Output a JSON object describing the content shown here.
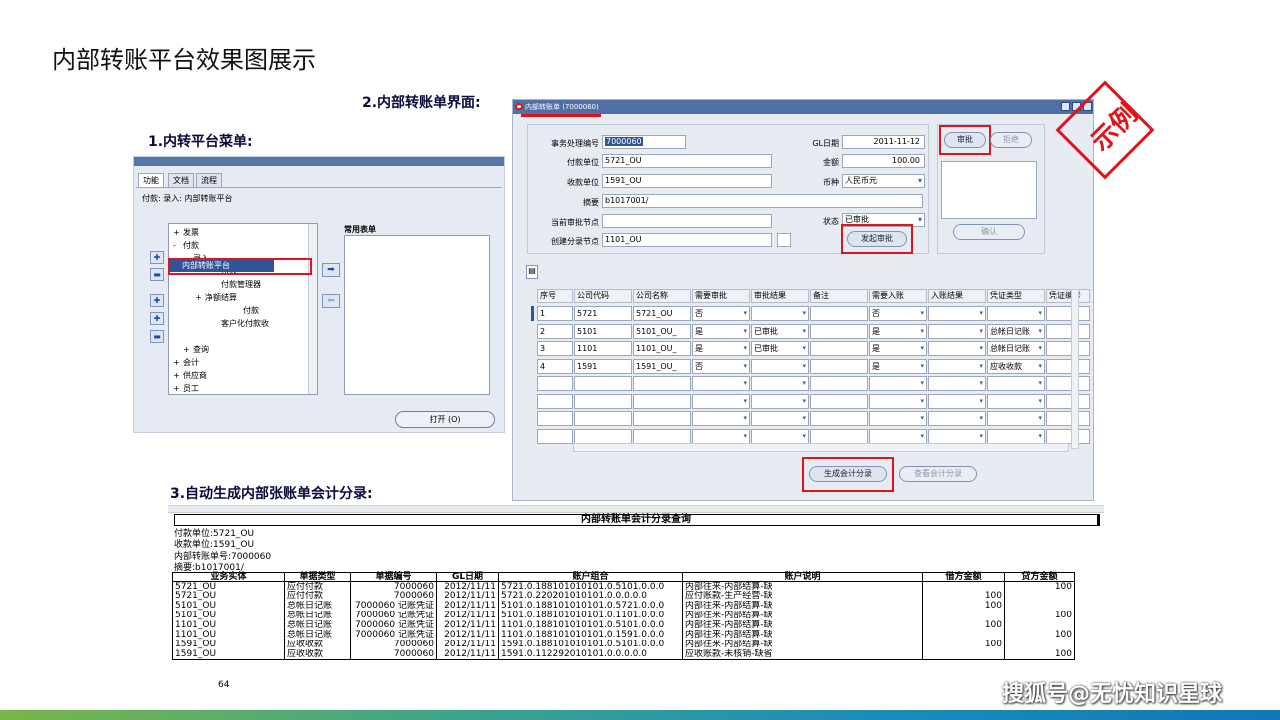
{
  "slide": {
    "title": "内部转账平台效果图展示",
    "caption_form": "2.内部转账单界面:",
    "caption_menu": "1.内转平台菜单:",
    "caption_entries": "3.自动生成内部张账单会计分录:",
    "page_number": "64",
    "stamp_text": "示例",
    "footer_watermark": "搜狐号@无忧知识星球"
  },
  "menu_panel": {
    "tabs": [
      "功能",
      "文档",
      "流程"
    ],
    "path": "付款: 录入: 内部转账平台",
    "tree": [
      {
        "sign": "+",
        "label": "发票",
        "level": 0
      },
      {
        "sign": "-",
        "label": "付款",
        "level": 0
      },
      {
        "sign": "-",
        "label": "录入",
        "level": 1
      },
      {
        "sign": "",
        "label": "付款",
        "level": 3
      },
      {
        "sign": "",
        "label": "付款管理器",
        "level": 3
      },
      {
        "sign": "+",
        "label": "净额结算",
        "level": 2
      },
      {
        "sign": "",
        "label": "付款",
        "level": 4
      },
      {
        "sign": "",
        "label": "客户化付款收",
        "level": 3
      },
      {
        "sign": "+",
        "label": "查询",
        "level": 1
      },
      {
        "sign": "+",
        "label": "会计",
        "level": 0
      },
      {
        "sign": "+",
        "label": "供应商",
        "level": 0
      },
      {
        "sign": "+",
        "label": "员工",
        "level": 0
      }
    ],
    "selected_item": "内部转账平台",
    "favorites_label": "常用表单",
    "open_button": "打开 (O)"
  },
  "form": {
    "window_title": "内部转账单 (7000060)",
    "labels": {
      "txn_no": "事务处理编号",
      "payer": "付款单位",
      "payee": "收款单位",
      "summary": "摘要",
      "approval_node": "当前审批节点",
      "create_node": "创建分录节点",
      "gl_date": "GL日期",
      "amount": "金额",
      "currency": "币种",
      "status": "状态"
    },
    "values": {
      "txn_no": "7000060",
      "payer": "5721_OU",
      "payee": "1591_OU",
      "summary": "b1017001/",
      "approval_node": "",
      "create_node": "1101_OU",
      "gl_date": "2011-11-12",
      "amount": "100.00",
      "currency": "人民币元",
      "status": "已审批"
    },
    "buttons": {
      "approve": "审批",
      "reject": "拒绝",
      "launch_approval": "发起审批",
      "confirm": "确认",
      "generate_entries": "生成会计分录",
      "view_entries": "查看会计分录"
    },
    "grid_headers": [
      "序号",
      "公司代码",
      "公司名称",
      "需要审批",
      "审批结果",
      "备注",
      "需要入账",
      "入账结果",
      "凭证类型",
      "凭证编号"
    ],
    "grid_rows": [
      [
        "1",
        "5721",
        "5721_OU",
        "否",
        "",
        "",
        "否",
        "",
        "",
        ""
      ],
      [
        "2",
        "5101",
        "5101_OU_",
        "是",
        "已审批",
        "",
        "是",
        "",
        "总帐日记账",
        ""
      ],
      [
        "3",
        "1101",
        "1101_OU_",
        "是",
        "已审批",
        "",
        "是",
        "",
        "总帐日记账",
        ""
      ],
      [
        "4",
        "1591",
        "1591_OU_",
        "否",
        "",
        "",
        "是",
        "",
        "应收收款",
        ""
      ]
    ]
  },
  "sheet": {
    "title": "内部转账单会计分录查询",
    "info": [
      "付款单位:5721_OU",
      "收款单位:1591_OU",
      "内部转账单号:7000060",
      "摘要:b1017001/"
    ],
    "headers": [
      "业务实体",
      "单据类型",
      "单据编号",
      "GL日期",
      "账户组合",
      "账户说明",
      "借方金额",
      "贷方金额"
    ],
    "rows": [
      [
        "5721_OU",
        "应付付款",
        "7000060",
        "2012/11/11",
        "5721.0.188101010101.0.5101.0.0.0",
        "内部往来-内部结算-缺",
        "",
        "100"
      ],
      [
        "5721_OU",
        "应付付款",
        "7000060",
        "2012/11/11",
        "5721.0.220201010101.0.0.0.0.0",
        "应付账款-生产经营-缺",
        "100",
        ""
      ],
      [
        "5101_OU",
        "总帐日记账",
        "7000060 记账凭证",
        "2012/11/11",
        "5101.0.188101010101.0.5721.0.0.0",
        "内部往来-内部结算-缺",
        "100",
        ""
      ],
      [
        "5101_OU",
        "总帐日记账",
        "7000060 记账凭证",
        "2012/11/11",
        "5101.0.188101010101.0.1101.0.0.0",
        "内部往来-内部结算-缺",
        "",
        "100"
      ],
      [
        "1101_OU",
        "总帐日记账",
        "7000060 记账凭证",
        "2012/11/11",
        "1101.0.188101010101.0.5101.0.0.0",
        "内部往来-内部结算-缺",
        "100",
        ""
      ],
      [
        "1101_OU",
        "总帐日记账",
        "7000060 记账凭证",
        "2012/11/11",
        "1101.0.188101010101.0.1591.0.0.0",
        "内部往来-内部结算-缺",
        "",
        "100"
      ],
      [
        "1591_OU",
        "应收收款",
        "7000060",
        "2012/11/11",
        "1591.0.188101010101.0.5101.0.0.0",
        "内部往来-内部结算-缺",
        "100",
        ""
      ],
      [
        "1591_OU",
        "应收收款",
        "7000060",
        "2012/11/11",
        "1591.0.112292010101.0.0.0.0.0",
        "应收账款-未核销-缺省",
        "",
        "100"
      ]
    ]
  },
  "colors": {
    "highlight_red": "#e0141a",
    "selection_blue": "#2f5597",
    "titlebar_blue": "#4f6fa5"
  }
}
